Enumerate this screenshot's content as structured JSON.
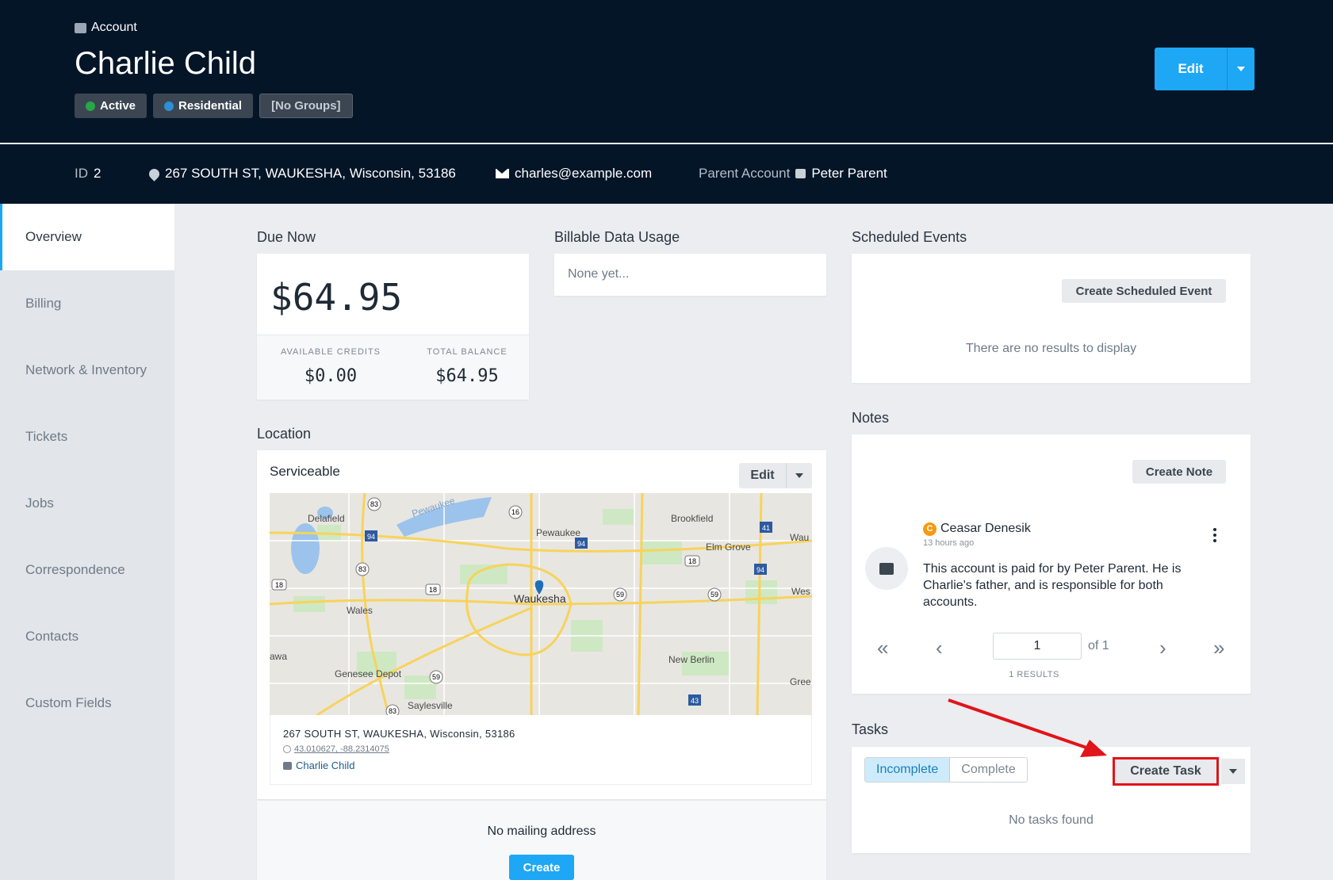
{
  "header": {
    "breadcrumb": "Account",
    "account_name": "Charlie Child",
    "badges": [
      {
        "label": "Active",
        "color": "#28a745"
      },
      {
        "label": "Residential",
        "color": "#2d8fd5"
      },
      {
        "label": "[No Groups]"
      }
    ],
    "edit_label": "Edit"
  },
  "meta": {
    "id_label": "ID",
    "id_value": "2",
    "address": "267 SOUTH ST, WAUKESHA, Wisconsin, 53186",
    "email": "charles@example.com",
    "parent_label": "Parent Account",
    "parent_name": "Peter Parent"
  },
  "sidebar": {
    "items": [
      {
        "label": "Overview",
        "active": true
      },
      {
        "label": "Billing"
      },
      {
        "label": "Network & Inventory"
      },
      {
        "label": "Tickets"
      },
      {
        "label": "Jobs"
      },
      {
        "label": "Correspondence"
      },
      {
        "label": "Contacts"
      },
      {
        "label": "Custom Fields"
      }
    ]
  },
  "due": {
    "title": "Due Now",
    "amount": "$64.95",
    "credits_label": "AVAILABLE CREDITS",
    "credits_value": "$0.00",
    "balance_label": "TOTAL BALANCE",
    "balance_value": "$64.95"
  },
  "usage": {
    "title": "Billable Data Usage",
    "empty_text": "None yet..."
  },
  "location": {
    "title": "Location",
    "status": "Serviceable",
    "edit_label": "Edit",
    "address": "267 SOUTH ST, WAUKESHA, Wisconsin, 53186",
    "coords": "43.010627, -88.2314075",
    "account_link": "Charlie Child",
    "map_labels": [
      "Pewaukee",
      "Delafield",
      "Pewaukee",
      "Brookfield",
      "Elm Grove",
      "Wau",
      "Wales",
      "Waukesha",
      "Wes",
      "awa",
      "Genesee Depot",
      "New Berlin",
      "Gree",
      "Saylesville"
    ],
    "map_shields": [
      "83",
      "94",
      "16",
      "41",
      "94",
      "18",
      "83",
      "18",
      "18",
      "59",
      "59",
      "94",
      "59",
      "43",
      "83"
    ],
    "no_mailing": "No mailing address",
    "create_label": "Create"
  },
  "scheduled": {
    "title": "Scheduled Events",
    "create_label": "Create Scheduled Event",
    "empty_text": "There are no results to display"
  },
  "notes": {
    "title": "Notes",
    "create_label": "Create Note",
    "author_initial": "C",
    "author": "Ceasar Denesik",
    "time": "13 hours ago",
    "body": "This account is paid for by Peter Parent. He is Charlie's father, and is responsible for both accounts.",
    "page_value": "1",
    "page_of": "of 1",
    "results": "1 RESULTS"
  },
  "tasks": {
    "title": "Tasks",
    "tab_incomplete": "Incomplete",
    "tab_complete": "Complete",
    "create_label": "Create Task",
    "empty_text": "No tasks found"
  }
}
